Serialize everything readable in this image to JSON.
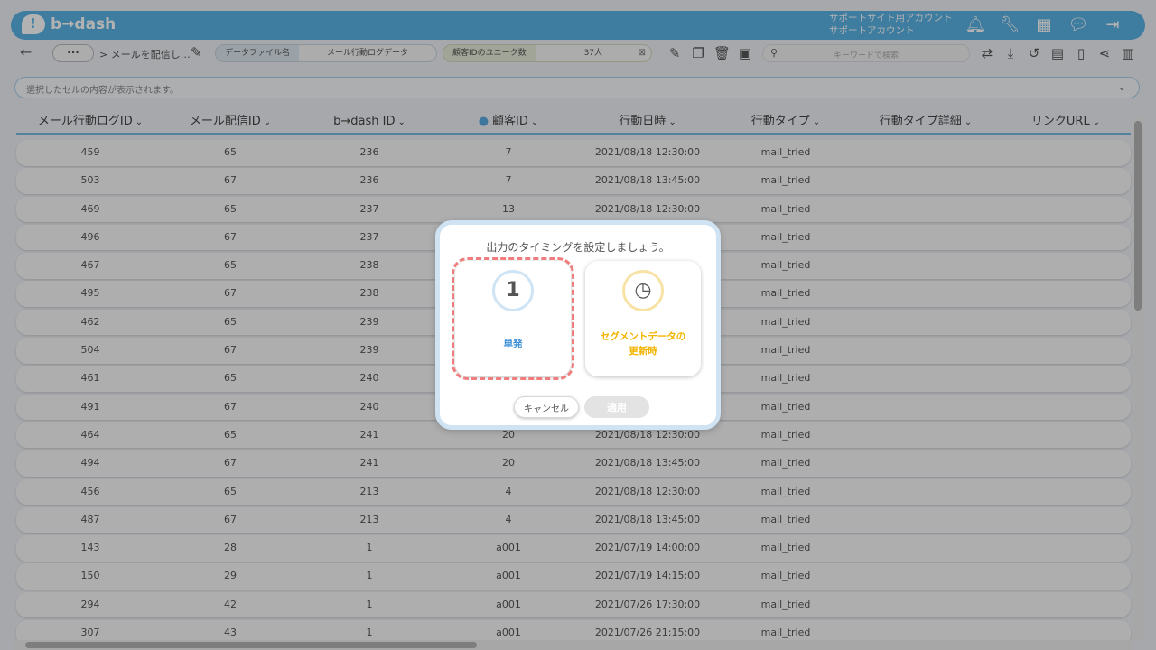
{
  "app": {
    "logo_text": "b→dash",
    "account_line1": "サポートサイト用アカウント",
    "account_line2": "サポートアカウント",
    "icons": [
      "bell-icon",
      "wrench-icon",
      "apps-grid-icon",
      "chat-icon",
      "logout-icon"
    ]
  },
  "toolbar": {
    "back": "←",
    "more": "···",
    "breadcrumb": "> メールを配信し…",
    "file_label": "データファイル名",
    "file_value": "メール行動ログデータ",
    "unique_label": "顧客IDのユニーク数",
    "unique_value": "37人",
    "search_placeholder": "キーワードで検索"
  },
  "cellbar": {
    "text": "選択したセルの内容が表示されます。"
  },
  "table": {
    "columns": [
      "メール行動ログID",
      "メール配信ID",
      "b→dash ID",
      "顧客ID",
      "行動日時",
      "行動タイプ",
      "行動タイプ詳細",
      "リンクURL"
    ],
    "rows": [
      [
        "459",
        "65",
        "236",
        "7",
        "2021/08/18 12:30:00",
        "mail_tried",
        "",
        ""
      ],
      [
        "503",
        "67",
        "236",
        "7",
        "2021/08/18 13:45:00",
        "mail_tried",
        "",
        ""
      ],
      [
        "469",
        "65",
        "237",
        "13",
        "2021/08/18 12:30:00",
        "mail_tried",
        "",
        ""
      ],
      [
        "496",
        "67",
        "237",
        "",
        "",
        "mail_tried",
        "",
        ""
      ],
      [
        "467",
        "65",
        "238",
        "",
        "",
        "mail_tried",
        "",
        ""
      ],
      [
        "495",
        "67",
        "238",
        "",
        "",
        "mail_tried",
        "",
        ""
      ],
      [
        "462",
        "65",
        "239",
        "",
        "",
        "mail_tried",
        "",
        ""
      ],
      [
        "504",
        "67",
        "239",
        "",
        "",
        "mail_tried",
        "",
        ""
      ],
      [
        "461",
        "65",
        "240",
        "",
        "",
        "mail_tried",
        "",
        ""
      ],
      [
        "491",
        "67",
        "240",
        "",
        "",
        "mail_tried",
        "",
        ""
      ],
      [
        "464",
        "65",
        "241",
        "20",
        "2021/08/18 12:30:00",
        "mail_tried",
        "",
        ""
      ],
      [
        "494",
        "67",
        "241",
        "20",
        "2021/08/18 13:45:00",
        "mail_tried",
        "",
        ""
      ],
      [
        "456",
        "65",
        "213",
        "4",
        "2021/08/18 12:30:00",
        "mail_tried",
        "",
        ""
      ],
      [
        "487",
        "67",
        "213",
        "4",
        "2021/08/18 13:45:00",
        "mail_tried",
        "",
        ""
      ],
      [
        "143",
        "28",
        "1",
        "a001",
        "2021/07/19 14:00:00",
        "mail_tried",
        "",
        ""
      ],
      [
        "150",
        "29",
        "1",
        "a001",
        "2021/07/19 14:15:00",
        "mail_tried",
        "",
        ""
      ],
      [
        "294",
        "42",
        "1",
        "a001",
        "2021/07/26 17:30:00",
        "mail_tried",
        "",
        ""
      ],
      [
        "307",
        "43",
        "1",
        "a001",
        "2021/07/26 21:15:00",
        "mail_tried",
        "",
        ""
      ]
    ]
  },
  "modal": {
    "title": "出力のタイミングを設定しましょう。",
    "option1_number": "1",
    "option1_label": "単発",
    "option2_label_line1": "セグメントデータの",
    "option2_label_line2": "更新時",
    "cancel": "キャンセル",
    "apply": "適用",
    "selected_option": "単発"
  }
}
